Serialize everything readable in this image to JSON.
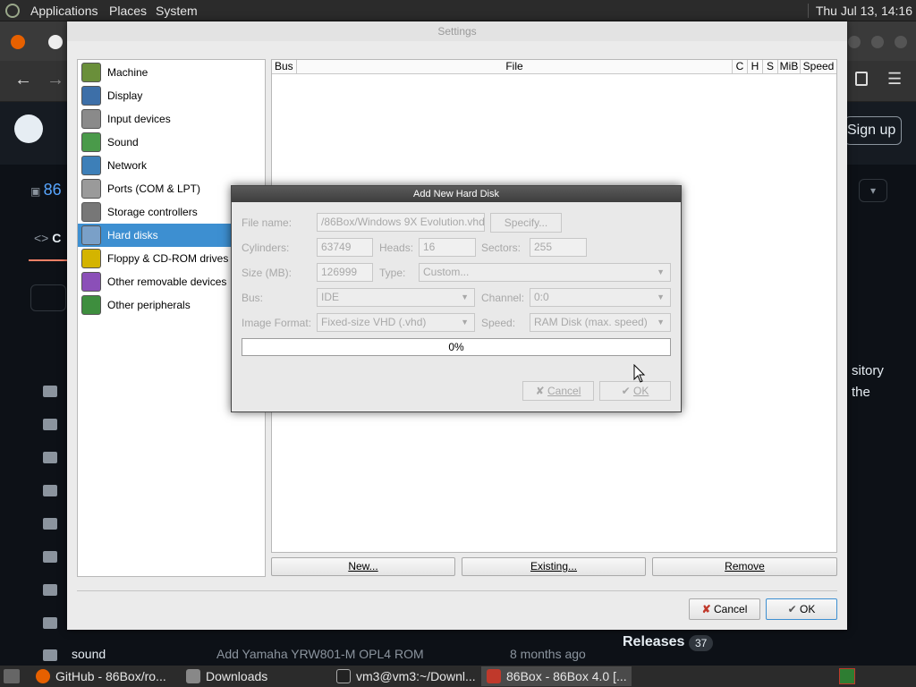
{
  "top_panel": {
    "menus": [
      "Applications",
      "Places",
      "System"
    ],
    "clock": "Thu Jul 13, 14:16"
  },
  "background_page": {
    "repo_prefix": "86",
    "code_tab_prefix": "C",
    "signup": "Sign up",
    "side_text": [
      "sitory",
      "the"
    ],
    "last_row": {
      "name": "sound",
      "message": "Add Yamaha YRW801-M OPL4 ROM",
      "date": "8 months ago"
    },
    "releases": "Releases",
    "releases_count": "37"
  },
  "settings": {
    "title": "Settings",
    "categories": [
      {
        "label": "Machine",
        "icon": "machine-icon"
      },
      {
        "label": "Display",
        "icon": "display-icon"
      },
      {
        "label": "Input devices",
        "icon": "input-devices-icon"
      },
      {
        "label": "Sound",
        "icon": "sound-icon"
      },
      {
        "label": "Network",
        "icon": "network-icon"
      },
      {
        "label": "Ports (COM & LPT)",
        "icon": "ports-icon"
      },
      {
        "label": "Storage controllers",
        "icon": "storage-controllers-icon"
      },
      {
        "label": "Hard disks",
        "icon": "hard-disks-icon"
      },
      {
        "label": "Floppy & CD-ROM drives",
        "icon": "floppy-cdrom-icon"
      },
      {
        "label": "Other removable devices",
        "icon": "removable-devices-icon"
      },
      {
        "label": "Other peripherals",
        "icon": "peripherals-icon"
      }
    ],
    "selected_category": "Hard disks",
    "table_columns": [
      "Bus",
      "File",
      "C",
      "H",
      "S",
      "MiB",
      "Speed"
    ],
    "buttons": {
      "new": "New...",
      "existing": "Existing...",
      "remove": "Remove"
    },
    "cancel": "Cancel",
    "ok": "OK"
  },
  "dialog": {
    "title": "Add New Hard Disk",
    "file_name_label": "File name:",
    "file_name_value": "/86Box/Windows 9X Evolution.vhd",
    "specify": "Specify...",
    "cylinders_label": "Cylinders:",
    "cylinders_value": "63749",
    "heads_label": "Heads:",
    "heads_value": "16",
    "sectors_label": "Sectors:",
    "sectors_value": "255",
    "size_label": "Size (MB):",
    "size_value": "126999",
    "type_label": "Type:",
    "type_value": "Custom...",
    "bus_label": "Bus:",
    "bus_value": "IDE",
    "channel_label": "Channel:",
    "channel_value": "0:0",
    "format_label": "Image Format:",
    "format_value": "Fixed-size VHD (.vhd)",
    "speed_label": "Speed:",
    "speed_value": "RAM Disk (max. speed)",
    "progress_text": "0%",
    "progress_value": 0,
    "cancel": "Cancel",
    "ok": "OK"
  },
  "taskbar": {
    "tasks": [
      "GitHub - 86Box/ro...",
      "Downloads",
      "vm3@vm3:~/Downl...",
      "86Box - 86Box 4.0 [..."
    ]
  }
}
